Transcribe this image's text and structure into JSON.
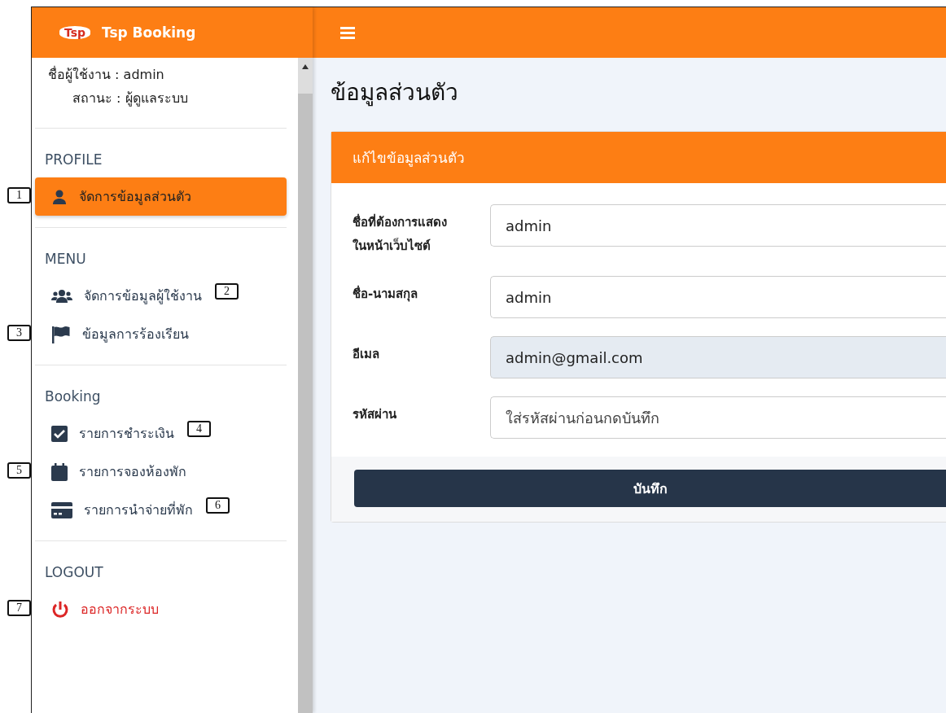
{
  "brand": {
    "logo_text": "Tsp",
    "name": "Tsp Booking"
  },
  "user": {
    "username_label": "ชื่อผู้ใช้งาน :",
    "username": "admin",
    "status_label": "สถานะ :",
    "status": "ผู้ดูแลระบบ"
  },
  "sidebar": {
    "sections": [
      {
        "title": "PROFILE",
        "items": [
          {
            "label": "จัดการข้อมูลส่วนตัว",
            "kind": "normal",
            "selected": true,
            "callout": "1"
          }
        ]
      },
      {
        "title": "MENU",
        "items": [
          {
            "label": "จัดการข้อมูลผู้ใช้งาน",
            "kind": "normal",
            "selected": false,
            "callout": "2"
          },
          {
            "label": "ข้อมูลการร้องเรียน",
            "kind": "normal",
            "selected": false,
            "callout": "3"
          }
        ]
      },
      {
        "title": "Booking",
        "items": [
          {
            "label": "รายการชำระเงิน",
            "kind": "normal",
            "selected": false,
            "callout": "4"
          },
          {
            "label": "รายการจองห้องพัก",
            "kind": "normal",
            "selected": false,
            "callout": "5"
          },
          {
            "label": "รายการนำจ่ายที่พัก",
            "kind": "normal",
            "selected": false,
            "callout": "6"
          }
        ]
      },
      {
        "title": "LOGOUT",
        "items": [
          {
            "label": "ออกจากระบบ",
            "kind": "logout",
            "selected": false,
            "callout": "7"
          }
        ]
      }
    ]
  },
  "page_title": "ข้อมูลส่วนตัว",
  "card": {
    "title": "แก้ไขข้อมูลส่วนตัว",
    "fields": [
      {
        "label": "ชื่อที่ต้องการแสดงในหน้าเว็บไซต์",
        "value": "admin",
        "disabled": false
      },
      {
        "label": "ชื่อ-นามสกุล",
        "value": "admin",
        "disabled": false
      },
      {
        "label": "อีเมล",
        "value": "admin@gmail.com",
        "disabled": true
      },
      {
        "label": "รหัสผ่าน",
        "placeholder": "ใส่รหัสผ่านก่อนกดบันทึก",
        "disabled": false
      }
    ],
    "submit": "บันทึก"
  }
}
